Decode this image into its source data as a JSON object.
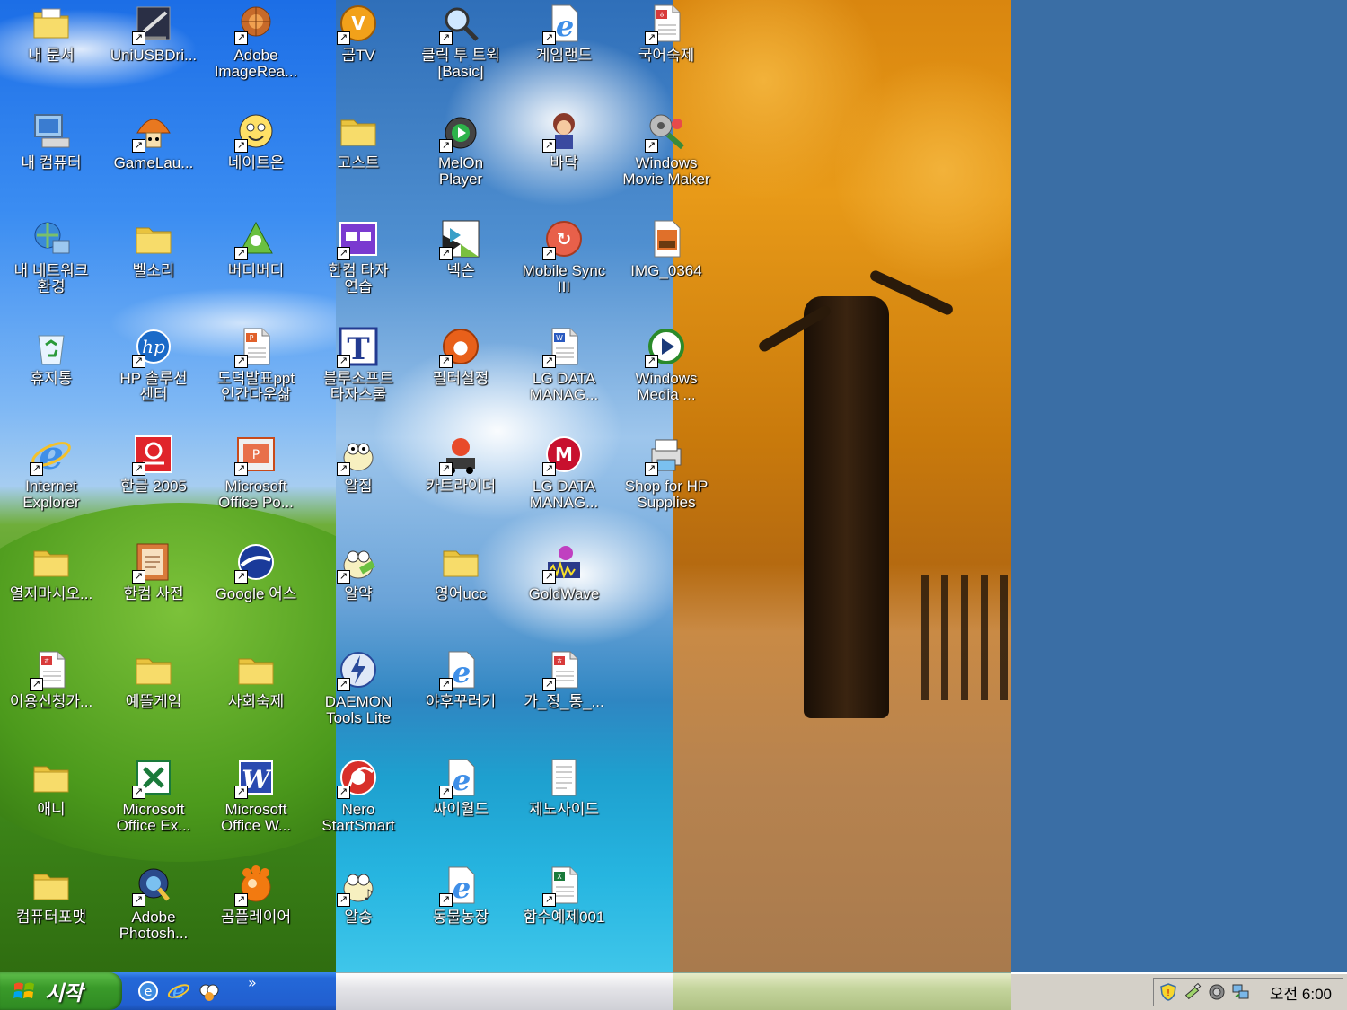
{
  "desktop": {
    "icons": [
      {
        "label": "내 문서",
        "icon": "folder-documents-icon"
      },
      {
        "label": "UniUSBDri...",
        "icon": "usb-driver-icon"
      },
      {
        "label": "Adobe\nImageRea...",
        "icon": "adobe-imageready-icon"
      },
      {
        "label": "곰TV",
        "icon": "gomtv-icon"
      },
      {
        "label": "클릭 투 트윅\n[Basic]",
        "icon": "magnifier-icon"
      },
      {
        "label": "게임랜드",
        "icon": "ie-document-icon"
      },
      {
        "label": "국어숙제",
        "icon": "hwp-document-icon"
      },
      {
        "label": "내 컴퓨터",
        "icon": "my-computer-icon"
      },
      {
        "label": "GameLau...",
        "icon": "mushroom-icon"
      },
      {
        "label": "네이트온",
        "icon": "nateon-icon"
      },
      {
        "label": "고스트",
        "icon": "folder-icon"
      },
      {
        "label": "MelOn\nPlayer",
        "icon": "melon-player-icon"
      },
      {
        "label": "바닥",
        "icon": "game-character-icon"
      },
      {
        "label": "Windows\nMovie Maker",
        "icon": "movie-maker-icon"
      },
      {
        "label": "내 네트워크\n환경",
        "icon": "network-icon"
      },
      {
        "label": "벨소리",
        "icon": "folder-icon"
      },
      {
        "label": "버디버디",
        "icon": "buddybuddy-icon"
      },
      {
        "label": "한컴 타자\n연습",
        "icon": "hancom-typing-icon"
      },
      {
        "label": "넥슨",
        "icon": "nexon-icon"
      },
      {
        "label": "Mobile Sync\nIII",
        "icon": "mobile-sync-icon"
      },
      {
        "label": "IMG_0364",
        "icon": "image-file-icon"
      },
      {
        "label": "휴지통",
        "icon": "recycle-bin-icon"
      },
      {
        "label": "HP 솔루션\n센터",
        "icon": "hp-icon"
      },
      {
        "label": "도덕발표ppt\n인간다운삶",
        "icon": "ppt-document-icon"
      },
      {
        "label": "블루소프트\n타자스쿨",
        "icon": "typing-school-icon"
      },
      {
        "label": "필터설정",
        "icon": "filter-icon"
      },
      {
        "label": "LG DATA\nMANAG...",
        "icon": "word-document-icon"
      },
      {
        "label": "Windows\nMedia ...",
        "icon": "media-player-icon"
      },
      {
        "label": "Internet\nExplorer",
        "icon": "internet-explorer-icon"
      },
      {
        "label": "한글 2005",
        "icon": "hangul-icon"
      },
      {
        "label": "Microsoft\nOffice Po...",
        "icon": "powerpoint-icon"
      },
      {
        "label": "알집",
        "icon": "alzip-icon"
      },
      {
        "label": "카트라이더",
        "icon": "kartrider-icon"
      },
      {
        "label": "LG DATA\nMANAG...",
        "icon": "lg-icon"
      },
      {
        "label": "Shop for HP\nSupplies",
        "icon": "printer-icon"
      },
      {
        "label": "열지마시오...",
        "icon": "folder-icon"
      },
      {
        "label": "한컴 사전",
        "icon": "hancom-dictionary-icon"
      },
      {
        "label": "Google 어스",
        "icon": "google-earth-icon"
      },
      {
        "label": "알약",
        "icon": "alyac-icon"
      },
      {
        "label": "영어ucc",
        "icon": "folder-icon"
      },
      {
        "label": "GoldWave",
        "icon": "goldwave-icon"
      },
      {
        "label": "",
        "icon": ""
      },
      {
        "label": "이용신청가...",
        "icon": "hwp-document-icon"
      },
      {
        "label": "예뜰게임",
        "icon": "folder-icon"
      },
      {
        "label": "사회숙제",
        "icon": "folder-icon"
      },
      {
        "label": "DAEMON\nTools Lite",
        "icon": "daemon-tools-icon"
      },
      {
        "label": "야후꾸러기",
        "icon": "ie-document-icon"
      },
      {
        "label": "가_정_통_...",
        "icon": "hwp-document-icon"
      },
      {
        "label": "",
        "icon": ""
      },
      {
        "label": "애니",
        "icon": "folder-icon"
      },
      {
        "label": "Microsoft\nOffice Ex...",
        "icon": "excel-icon"
      },
      {
        "label": "Microsoft\nOffice W...",
        "icon": "word-icon"
      },
      {
        "label": "Nero\nStartSmart",
        "icon": "nero-icon"
      },
      {
        "label": "싸이월드",
        "icon": "ie-document-icon"
      },
      {
        "label": "제노사이드",
        "icon": "text-document-icon"
      },
      {
        "label": "",
        "icon": ""
      },
      {
        "label": "컴퓨터포맷",
        "icon": "folder-icon"
      },
      {
        "label": "Adobe\nPhotosh...",
        "icon": "photoshop-icon"
      },
      {
        "label": "곰플레이어",
        "icon": "gomplayer-icon"
      },
      {
        "label": "알송",
        "icon": "alsong-icon"
      },
      {
        "label": "동물농장",
        "icon": "ie-document-icon"
      },
      {
        "label": "함수예제001",
        "icon": "excel-document-icon"
      },
      {
        "label": "",
        "icon": ""
      }
    ]
  },
  "taskbar": {
    "start_label": "시작",
    "quick_launch": [
      "ie-alt-icon",
      "internet-explorer-icon",
      "messenger-icon"
    ],
    "more": "»",
    "tray_icons": [
      "security-shield-icon",
      "usb-plug-icon",
      "speaker-icon",
      "network-tray-icon"
    ],
    "clock": "오전 6:00"
  }
}
